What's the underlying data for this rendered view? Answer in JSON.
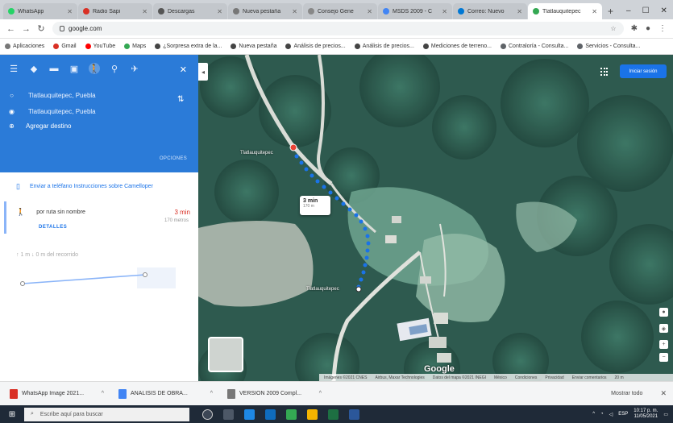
{
  "browser": {
    "tabs": [
      {
        "label": "WhatsApp",
        "active": false,
        "color": "#25d366"
      },
      {
        "label": "Radio Sapi",
        "active": false,
        "color": "#d93025"
      },
      {
        "label": "Descargas",
        "active": false,
        "color": "#555555"
      },
      {
        "label": "Nueva pestaña",
        "active": false,
        "color": "#777777"
      },
      {
        "label": "Consejo Gene",
        "active": false,
        "color": "#888888"
      },
      {
        "label": "MSDS 2009 - C",
        "active": false,
        "color": "#4285f4"
      },
      {
        "label": "Correo: Nuevo",
        "active": false,
        "color": "#0078d4"
      },
      {
        "label": "Tlatlauquitepec",
        "active": true,
        "color": "#34a853"
      }
    ],
    "url": "google.com",
    "bookmarks": [
      {
        "label": "Aplicaciones",
        "color": "#777777"
      },
      {
        "label": "Gmail",
        "color": "#d93025"
      },
      {
        "label": "YouTube",
        "color": "#ff0000"
      },
      {
        "label": "Maps",
        "color": "#34a853"
      },
      {
        "label": "¿Sorpresa extra de la...",
        "color": "#444444"
      },
      {
        "label": "Nueva pestaña",
        "color": "#444444"
      },
      {
        "label": "Análisis de precios...",
        "color": "#444444"
      },
      {
        "label": "Análisis de precios...",
        "color": "#444444"
      },
      {
        "label": "Mediciones de terreno...",
        "color": "#444444"
      },
      {
        "label": "Contraloría - Consulta...",
        "color": "#5f6368"
      },
      {
        "label": "Servicios - Consulta...",
        "color": "#5f6368"
      }
    ]
  },
  "directions": {
    "origin": "Tlatlauquitepec, Puebla",
    "destination": "Tlatlauquitepec, Puebla",
    "add_destination": "Agregar destino",
    "options_label": "OPCIONES",
    "send_to_phone": "Enviar a teléfano Instrucciones sobre Camelloper",
    "route_name": "por ruta sin nombre",
    "route_time": "3 min",
    "route_distance": "170 metros",
    "details_label": "DETALLES",
    "elevation_label": "↑ 1 m  ↓ 0 m  del recorrido"
  },
  "map": {
    "signin_label": "Iniciar sesión",
    "pin_label": "Tlatlauquitepec",
    "bottom_label": "Tlatlauquitepec",
    "bubble_time": "3 min",
    "bubble_distance": "170 m",
    "google_logo": "Google",
    "footer_items": [
      "Imágenes ©2021 CNES",
      "Airbus, Maxar Technologies",
      "Datos del mapa ©2021 INEGI",
      "México",
      "Condiciones",
      "Privacidad",
      "Enviar comentarios",
      "20 m"
    ]
  },
  "downloads": [
    {
      "label": "WhatsApp Image 2021...",
      "color": "#d93025"
    },
    {
      "label": "ANALISIS DE OBRA...",
      "color": "#4285f4"
    },
    {
      "label": "VERSION 2009 Compl...",
      "color": "#777777"
    }
  ],
  "downloads_show_all": "Mostrar todo",
  "taskbar": {
    "search_placeholder": "Escribe aquí para buscar",
    "lang": "ESP",
    "time": "10:17 p. m.",
    "date": "11/05/2021"
  }
}
